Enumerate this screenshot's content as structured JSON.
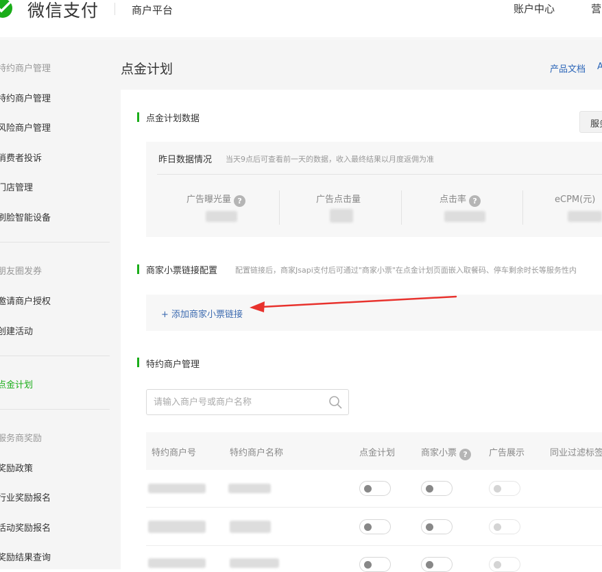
{
  "header": {
    "brand": "微信支付",
    "platform": "商户平台",
    "nav_account": "账户中心",
    "nav_partial": "营"
  },
  "sidebar": {
    "groups": [
      {
        "title": "特约商户管理",
        "items": [
          "特约商户管理",
          "风险商户管理",
          "消费者投诉",
          "门店管理",
          "刷脸智能设备"
        ]
      },
      {
        "title": "朋友圈发券",
        "items": [
          "邀请商户授权",
          "创建活动"
        ]
      },
      {
        "title": "",
        "items": [
          "点金计划"
        ]
      },
      {
        "title": "服务商奖励",
        "items": [
          "奖励政策",
          "行业奖励报名",
          "活动奖励报名",
          "奖励结果查询"
        ]
      }
    ],
    "active_item": "点金计划"
  },
  "page": {
    "title": "点金计划",
    "doc_link": "产品文档",
    "doc_link_partial": "A"
  },
  "data_section": {
    "title": "点金计划数据",
    "service_button": "服务",
    "stats_heading": "昨日数据情况",
    "stats_note": "当天9点后可查看前一天的数据，收入最终结果以月度返佣为准",
    "metrics": [
      {
        "label": "广告曝光量",
        "help": true
      },
      {
        "label": "广告点击量",
        "help": false
      },
      {
        "label": "点击率",
        "help": true
      },
      {
        "label": "eCPM(元)",
        "help": false
      }
    ],
    "help_glyph": "?"
  },
  "receipt_section": {
    "title": "商家小票链接配置",
    "desc": "配置链接后，商家Jsapi支付后可通过\"商家小票\"在点金计划页面嵌入取餐码、停车剩余时长等服务性内",
    "add_link": "+ 添加商家小票链接"
  },
  "merchant_section": {
    "title": "特约商户管理",
    "search_placeholder": "请输入商户号或商户名称",
    "columns": [
      "特约商户号",
      "特约商户名称",
      "点金计划",
      "商家小票",
      "广告展示",
      "同业过滤标签"
    ]
  },
  "colors": {
    "accent": "#1aad19",
    "link": "#3d6bb0",
    "arrow": "#e8322d"
  },
  "icons": {
    "logo": "wechat-pay-logo-icon",
    "search": "search-icon",
    "help": "question-icon"
  }
}
